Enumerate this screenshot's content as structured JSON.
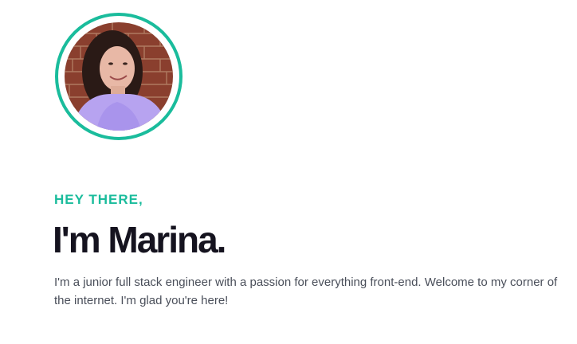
{
  "hero": {
    "greeting": "HEY THERE,",
    "headline": "I'm Marina.",
    "intro": "I'm a junior full stack engineer with a passion for everything front-end. Welcome to my corner of the internet. I'm glad you're here!",
    "avatar_alt": "Portrait photo of Marina"
  },
  "colors": {
    "accent": "#1abc9c",
    "heading": "#15131f",
    "body_text": "#4a4f5a",
    "background": "#ffffff"
  }
}
